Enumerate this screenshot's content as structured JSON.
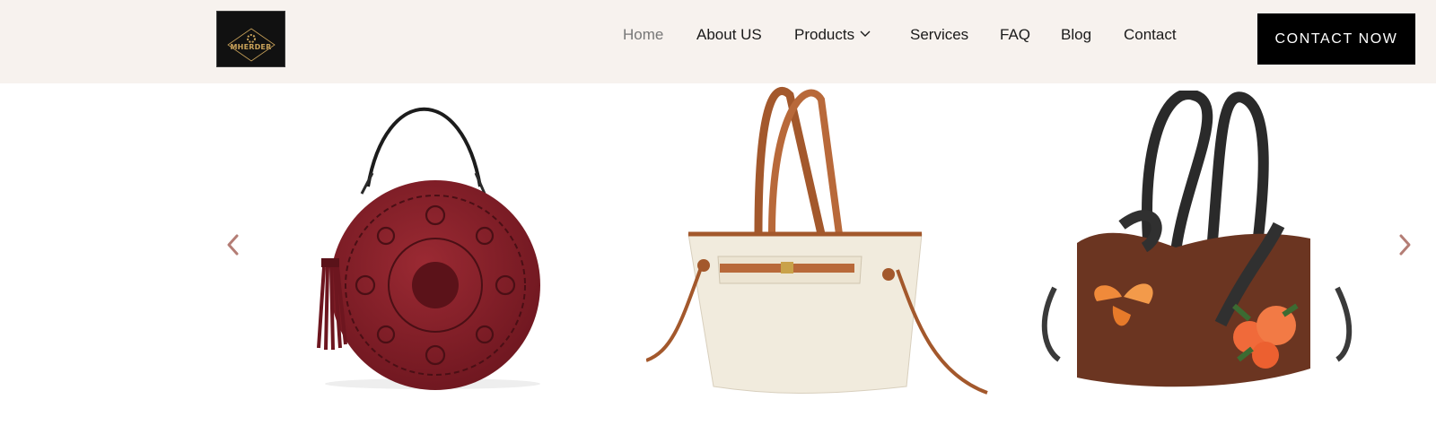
{
  "brand": {
    "logo_text": "MHERDER"
  },
  "nav": {
    "items": [
      {
        "label": "Home",
        "active": true
      },
      {
        "label": "About US"
      },
      {
        "label": "Products",
        "has_dropdown": true
      },
      {
        "label": "Services"
      },
      {
        "label": "FAQ"
      },
      {
        "label": "Blog"
      },
      {
        "label": "Contact"
      }
    ]
  },
  "cta": {
    "label": "CONTACT NOW"
  },
  "colors": {
    "header_bg": "#f7f2ee",
    "cta_bg": "#000000",
    "arrow": "#b47d75",
    "active_nav": "#777777"
  },
  "carousel": {
    "icons": {
      "prev": "chevron-left-icon",
      "next": "chevron-right-icon"
    },
    "slides": [
      {
        "product": "round burgundy embossed leather bag with tassel"
      },
      {
        "product": "cream tote bag with tan leather handles"
      },
      {
        "product": "brown leather handbag with painted butterfly and peonies"
      }
    ]
  }
}
